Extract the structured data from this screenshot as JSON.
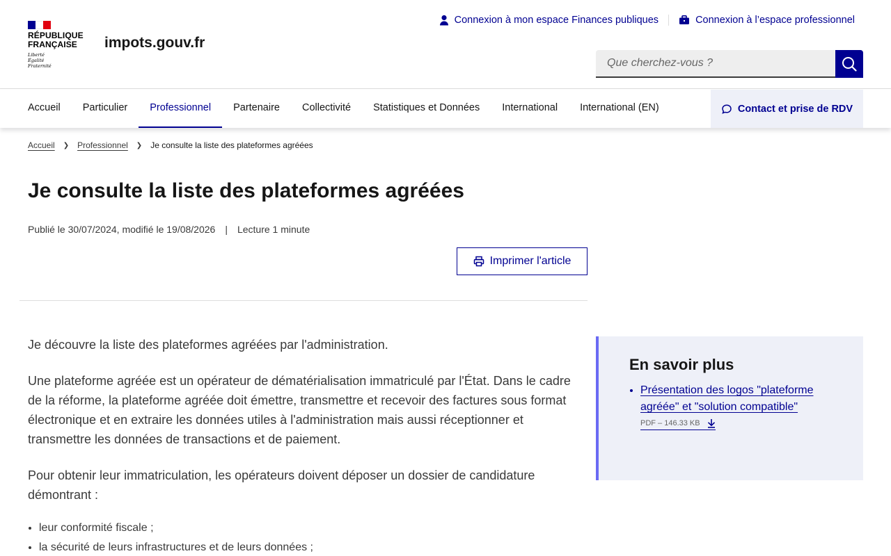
{
  "brand": {
    "republic_line1": "RÉPUBLIQUE",
    "republic_line2": "FRANÇAISE",
    "motto_1": "Liberté",
    "motto_2": "Égalité",
    "motto_3": "Fraternité",
    "site_name": "impots.gouv.fr",
    "flag_colors": [
      "#000091",
      "#ffffff",
      "#e1000f"
    ]
  },
  "top_links": {
    "finances": "Connexion à mon espace Finances publiques",
    "pro": "Connexion à l’espace professionnel"
  },
  "search": {
    "placeholder": "Que cherchez-vous ?",
    "button_icon": "search-icon"
  },
  "nav": {
    "items": [
      {
        "label": "Accueil"
      },
      {
        "label": "Particulier"
      },
      {
        "label": "Professionnel"
      },
      {
        "label": "Partenaire"
      },
      {
        "label": "Collectivité"
      },
      {
        "label": "Statistiques et Données"
      },
      {
        "label": "International"
      },
      {
        "label": "International (EN)"
      }
    ],
    "active": "Professionnel",
    "contact": "Contact et prise de RDV"
  },
  "breadcrumb": {
    "home": "Accueil",
    "section": "Professionnel",
    "current": "Je consulte la liste des plateformes agréées"
  },
  "article": {
    "title": "Je consulte la liste des plateformes agréées",
    "published": "Publié le 30/07/2024, modifié le 19/08/2026",
    "separator": "|",
    "reading": "Lecture 1 minute",
    "print_label": "Imprimer l'article",
    "paragraphs": [
      "Je découvre la liste des plateformes agréées par l'administration.",
      "Une plateforme agréée est un opérateur de dématérialisation immatriculé par l'État. Dans le cadre de la réforme, la plateforme agréée doit émettre, transmettre et recevoir des factures sous format électronique et en extraire les données utiles à l'administration mais aussi réceptionner et transmettre les données de transactions et de paiement.",
      "Pour obtenir leur immatriculation, les opérateurs doivent déposer un dossier de candidature démontrant :"
    ],
    "bullets": [
      "leur conformité fiscale ;",
      "la sécurité de leurs infrastructures et de leurs données ;"
    ]
  },
  "aside": {
    "title": "En savoir plus",
    "link": "Présentation des logos \"plateforme agréée\" et \"solution compatible\"",
    "file_info": "PDF – 146.33 KB"
  },
  "colors": {
    "primary": "#000091",
    "aside_bg": "#eef0f8",
    "aside_border": "#6a6af4"
  }
}
